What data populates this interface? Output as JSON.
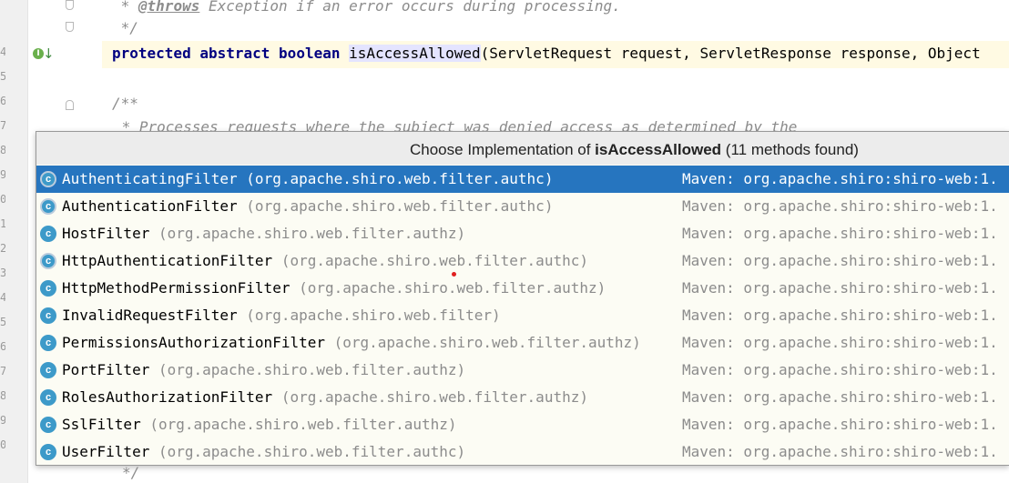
{
  "editor": {
    "line_numbers": [
      "",
      "",
      "4",
      "5",
      "6",
      "7",
      "8",
      "9",
      "0",
      "1",
      "2",
      "3",
      "4",
      "5",
      "6",
      "7",
      "8",
      "9",
      "0"
    ],
    "lines": {
      "throws_prefix": " * ",
      "throws_tag": "@throws",
      "throws_text": " Exception if an error occurs during processing.",
      "comment_close": " */",
      "kw_protected": "protected",
      "kw_abstract": "abstract",
      "kw_boolean": "boolean",
      "method_name": "isAccessAllowed",
      "signature_rest": "(ServletRequest request, ServletResponse response, Object",
      "javadoc_open": "/**",
      "processes_text": " * Processes requests where the subject was denied access as determined by the",
      "bottom_close": "*/"
    }
  },
  "popup": {
    "title_prefix": "Choose Implementation of ",
    "title_method": "isAccessAllowed",
    "title_suffix": " (11 methods found)",
    "items": [
      {
        "name": "AuthenticatingFilter",
        "pkg": "(org.apache.shiro.web.filter.authc)",
        "source": "Maven: org.apache.shiro:shiro-web:1.",
        "abstract": true
      },
      {
        "name": "AuthenticationFilter",
        "pkg": "(org.apache.shiro.web.filter.authc)",
        "source": "Maven: org.apache.shiro:shiro-web:1.",
        "abstract": true
      },
      {
        "name": "HostFilter",
        "pkg": "(org.apache.shiro.web.filter.authz)",
        "source": "Maven: org.apache.shiro:shiro-web:1.",
        "abstract": false
      },
      {
        "name": "HttpAuthenticationFilter",
        "pkg": "(org.apache.shiro.web.filter.authc)",
        "source": "Maven: org.apache.shiro:shiro-web:1.",
        "abstract": true
      },
      {
        "name": "HttpMethodPermissionFilter",
        "pkg": "(org.apache.shiro.web.filter.authz)",
        "source": "Maven: org.apache.shiro:shiro-web:1.",
        "abstract": false
      },
      {
        "name": "InvalidRequestFilter",
        "pkg": "(org.apache.shiro.web.filter)",
        "source": "Maven: org.apache.shiro:shiro-web:1.",
        "abstract": false
      },
      {
        "name": "PermissionsAuthorizationFilter",
        "pkg": "(org.apache.shiro.web.filter.authz)",
        "source": "Maven: org.apache.shiro:shiro-web:1.",
        "abstract": false
      },
      {
        "name": "PortFilter",
        "pkg": "(org.apache.shiro.web.filter.authz)",
        "source": "Maven: org.apache.shiro:shiro-web:1.",
        "abstract": false
      },
      {
        "name": "RolesAuthorizationFilter",
        "pkg": "(org.apache.shiro.web.filter.authz)",
        "source": "Maven: org.apache.shiro:shiro-web:1.",
        "abstract": false
      },
      {
        "name": "SslFilter",
        "pkg": "(org.apache.shiro.web.filter.authz)",
        "source": "Maven: org.apache.shiro:shiro-web:1.",
        "abstract": false
      },
      {
        "name": "UserFilter",
        "pkg": "(org.apache.shiro.web.filter.authc)",
        "source": "Maven: org.apache.shiro:shiro-web:1.",
        "abstract": false
      }
    ],
    "selected_index": 0,
    "icon_glyph": "c"
  },
  "gutter": {
    "implemented_icon_glyph": "I",
    "implemented_arrow_glyph": "↓"
  },
  "colors": {
    "selection": "#2675bf",
    "keyword": "#000080",
    "comment": "#8c8c8c",
    "class_icon": "#3d9ac9"
  }
}
